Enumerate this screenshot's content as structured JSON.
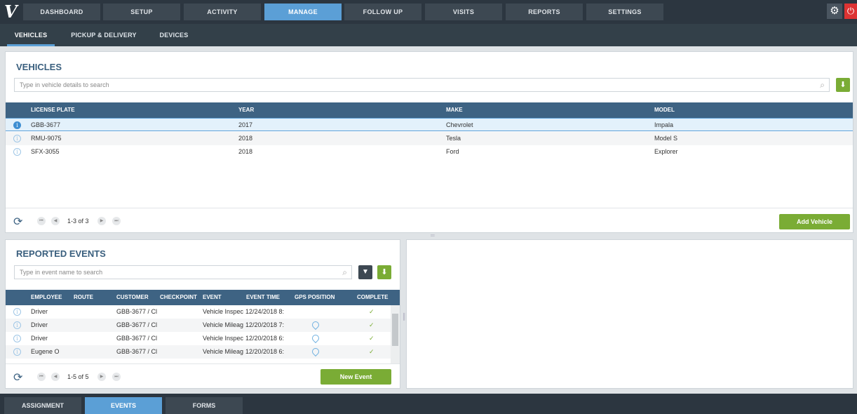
{
  "nav": {
    "tabs": [
      "DASHBOARD",
      "SETUP",
      "ACTIVITY",
      "MANAGE",
      "FOLLOW UP",
      "VISITS",
      "REPORTS",
      "SETTINGS"
    ],
    "active": "MANAGE"
  },
  "subnav": {
    "tabs": [
      "VEHICLES",
      "PICKUP & DELIVERY",
      "DEVICES"
    ],
    "active": "VEHICLES"
  },
  "vehicles": {
    "title": "VEHICLES",
    "search_placeholder": "Type in vehicle details to search",
    "columns": [
      "LICENSE PLATE",
      "YEAR",
      "MAKE",
      "MODEL"
    ],
    "rows": [
      [
        "GBB-3677",
        "2017",
        "Chevrolet",
        "Impala"
      ],
      [
        "RMU-9075",
        "2018",
        "Tesla",
        "Model S"
      ],
      [
        "SFX-3055",
        "2018",
        "Ford",
        "Explorer"
      ]
    ],
    "selected_row": 0,
    "pager_text": "1-3 of 3",
    "add_button": "Add Vehicle"
  },
  "events": {
    "title": "REPORTED EVENTS",
    "search_placeholder": "Type in event name to search",
    "columns": [
      "EMPLOYEE",
      "ROUTE",
      "CUSTOMER",
      "CHECKPOINT",
      "EVENT",
      "EVENT TIME",
      "GPS POSITION",
      "COMPLETE"
    ],
    "rows": [
      {
        "employee": "Driver",
        "route": "",
        "customer": "GBB-3677 / Cl",
        "checkpoint": "",
        "event": "Vehicle Inspec",
        "time": "12/24/2018 8:",
        "gps": false,
        "complete": true
      },
      {
        "employee": "Driver",
        "route": "",
        "customer": "GBB-3677 / Cl",
        "checkpoint": "",
        "event": "Vehicle Mileag",
        "time": "12/20/2018 7:",
        "gps": true,
        "complete": true
      },
      {
        "employee": "Driver",
        "route": "",
        "customer": "GBB-3677 / Cl",
        "checkpoint": "",
        "event": "Vehicle Inspec",
        "time": "12/20/2018 6:",
        "gps": true,
        "complete": true
      },
      {
        "employee": "Eugene O",
        "route": "",
        "customer": "GBB-3677 / Cl",
        "checkpoint": "",
        "event": "Vehicle Mileag",
        "time": "12/20/2018 6:",
        "gps": true,
        "complete": true
      }
    ],
    "pager_text": "1-5 of 5",
    "new_button": "New Event"
  },
  "bottom": {
    "tabs": [
      "ASSIGNMENT",
      "EVENTS",
      "FORMS"
    ],
    "active": "EVENTS"
  },
  "icons": {
    "logo": "V",
    "gear": "⚙",
    "power": "⏻",
    "search": "⌕",
    "download": "⬇",
    "filter": "▼",
    "refresh": "⟳",
    "first": "⏮",
    "prev": "◀",
    "next": "▶",
    "last": "⏭",
    "info": "i",
    "check": "✓"
  },
  "colors": {
    "accent": "#5b9fd6",
    "green": "#7aac35",
    "header": "#3e6383",
    "nav": "#2c3640"
  }
}
